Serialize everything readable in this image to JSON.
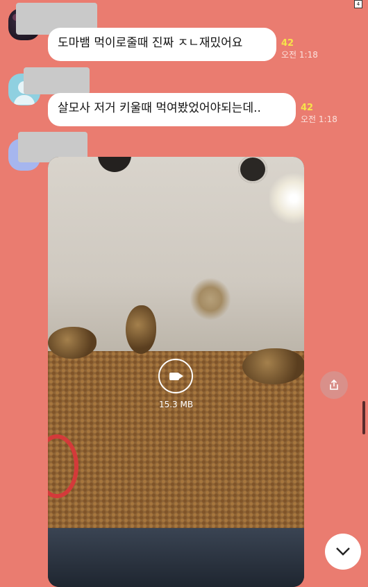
{
  "badge": "4",
  "messages": [
    {
      "text": "도마뱀 먹이로줄때 진짜 ㅈㄴ재밌어요",
      "count": "42",
      "time": "오전 1:18"
    },
    {
      "text": "살모사 저거 키울때 먹여봤었어야되는데..",
      "count": "42",
      "time": "오전 1:18"
    }
  ],
  "video": {
    "size": "15.3 MB"
  },
  "icons": {
    "video": "video-camera-icon",
    "share": "share-icon",
    "scroll_down": "chevron-down-icon"
  },
  "colors": {
    "chat_background": "#ea7c70",
    "bubble": "#ffffff",
    "unread_count": "#f7e34a"
  }
}
